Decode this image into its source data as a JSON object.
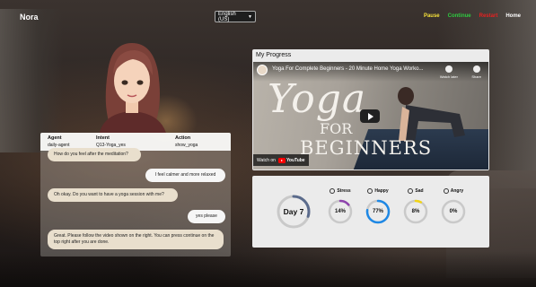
{
  "app": {
    "title": "Nora"
  },
  "language": {
    "selected": "English (US)"
  },
  "nav": {
    "pause": "Pause",
    "continue": "Continue",
    "restart": "Restart",
    "home": "Home"
  },
  "colors": {
    "pause": "#f5e13a",
    "continue": "#2ecc40",
    "restart": "#e82020",
    "home": "#ffffff",
    "stress": "#8e44ad",
    "happy": "#1e88e5",
    "sad": "#f1d417",
    "angry": "#e53935",
    "day": "#5b6b8c"
  },
  "chat": {
    "header": {
      "agent_label": "Agent",
      "agent_value": "daily-agent",
      "intent_label": "Intent",
      "intent_value": "Q13-Yoga_yes",
      "action_label": "Action",
      "action_value": "show_yoga"
    },
    "messages": [
      {
        "role": "bot",
        "text": "How do you feel after the meditation?"
      },
      {
        "role": "user",
        "text": "I feel calmer and more relaxed"
      },
      {
        "role": "bot",
        "text": "Oh okay. Do you want to have a yoga session with me?"
      },
      {
        "role": "user",
        "text": "yes please"
      },
      {
        "role": "bot",
        "text": "Great. Please follow the video shown on the right. You can press continue on the top right after you are done."
      }
    ]
  },
  "progress": {
    "title": "My Progress",
    "video": {
      "title": "Yoga For Complete Beginners - 20 Minute Home Yoga Worko...",
      "watch_later": "Watch later",
      "share": "Share",
      "thumb_yoga": "Yoga",
      "thumb_for": "FOR",
      "thumb_beginners": "BEGINNERS",
      "watch_on": "Watch on",
      "youtube": "YouTube"
    }
  },
  "stats": {
    "day_label": "Day 7",
    "day_fraction": 0.3,
    "metrics": [
      {
        "key": "stress",
        "label": "Stress",
        "value": 14,
        "value_text": "14%"
      },
      {
        "key": "happy",
        "label": "Happy",
        "value": 77,
        "value_text": "77%"
      },
      {
        "key": "sad",
        "label": "Sad",
        "value": 8,
        "value_text": "8%"
      },
      {
        "key": "angry",
        "label": "Angry",
        "value": 0,
        "value_text": "0%"
      }
    ]
  }
}
